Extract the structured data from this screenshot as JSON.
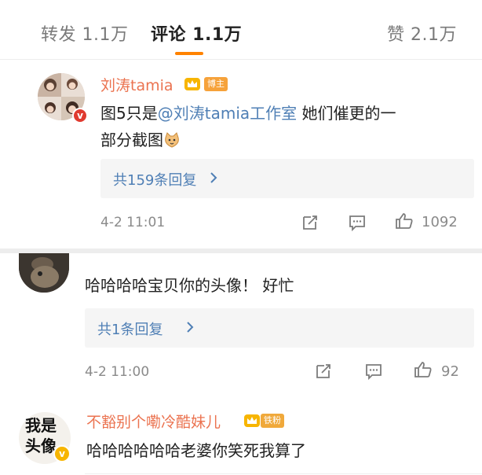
{
  "tabs": {
    "repost": "转发 1.1万",
    "comments": "评论 1.1万",
    "likes": "赞 2.1万"
  },
  "colors": {
    "accent": "#ff8200",
    "username": "#eb7350",
    "link": "#4f7fb5",
    "meta": "#8a8a8a"
  },
  "comment1": {
    "username": "刘涛tamia",
    "tag": "博主",
    "text_line1_prefix": "图5只是",
    "mention": "@刘涛tamia工作室",
    "text_line1_suffix": " 她们催更的一",
    "text_line2": "部分截图",
    "emoji": "cat-face-emoji",
    "reply_label": "共159条回复",
    "time": "4-2 11:01",
    "like_count": "1092"
  },
  "comment2": {
    "text": "哈哈哈哈宝贝你的头像！   好忙",
    "reply_label": "共1条回复",
    "time": "4-2 11:00",
    "like_count": "92"
  },
  "comment3": {
    "username": "不豁别个嘞冷酷妹儿",
    "tag": "铁粉",
    "avatar_text": "我是头像",
    "text": "哈哈哈哈哈哈老婆你笑死我算了"
  },
  "icons": [
    "crown-icon",
    "verified-icon",
    "repost-icon",
    "comment-icon",
    "like-icon",
    "chevron-right-icon"
  ]
}
